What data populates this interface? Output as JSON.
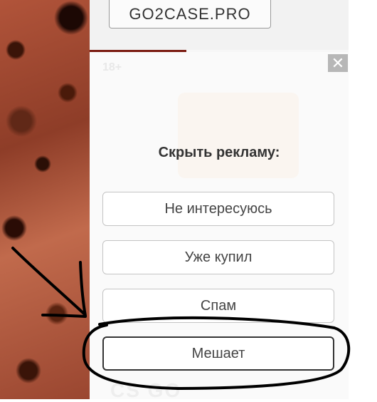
{
  "header": {
    "brand": "GO2CASE.PRO"
  },
  "ad_panel": {
    "age_badge": "18+",
    "close_label": "✕",
    "title": "Скрыть рекламу:",
    "options": [
      {
        "label": "Не интересуюсь"
      },
      {
        "label": "Уже купил"
      },
      {
        "label": "Спам"
      },
      {
        "label": "Мешает"
      }
    ],
    "ghost_text": "CS GO"
  },
  "annotation": {
    "color": "#000000"
  }
}
